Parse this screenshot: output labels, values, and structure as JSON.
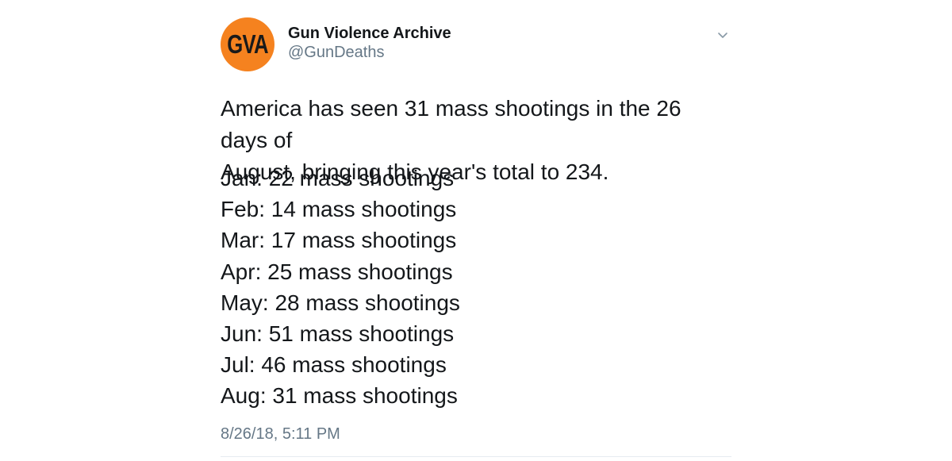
{
  "author": {
    "avatar_text": "GVA",
    "avatar_color": "#f5821f",
    "display_name": "Gun Violence Archive",
    "handle": "@GunDeaths"
  },
  "tweet": {
    "text_line1": "America has seen 31 mass shootings in the 26 days of",
    "text_line2": "August, bringing this year's total to 234.",
    "months": [
      "Jan: 22 mass shootings",
      "Feb: 14 mass shootings",
      "Mar: 17 mass shootings",
      "Apr: 25 mass shootings",
      "May: 28 mass shootings",
      "Jun: 51 mass shootings",
      "Jul: 46 mass shootings",
      "Aug: 31 mass shootings"
    ],
    "timestamp": "8/26/18, 5:11 PM"
  },
  "icons": {
    "caret": "chevron-down-icon"
  },
  "colors": {
    "text": "#14171a",
    "secondary": "#657786",
    "divider": "#e6ecf0"
  }
}
